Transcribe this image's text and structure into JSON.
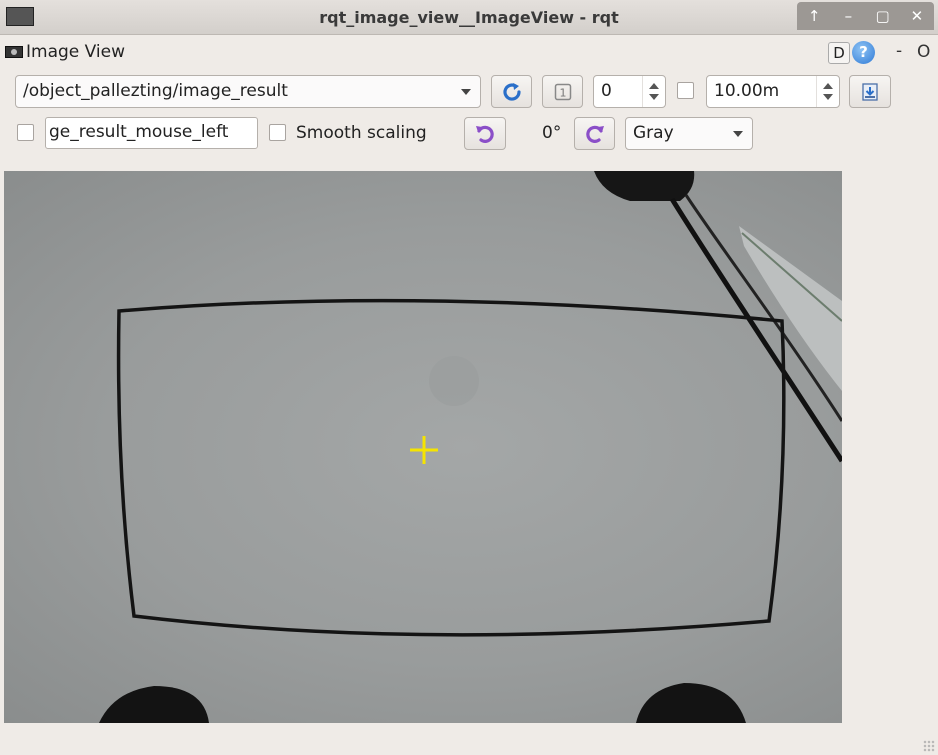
{
  "window": {
    "title": "rqt_image_view__ImageView - rqt",
    "controls": [
      "↑",
      "–",
      "▢",
      "✕"
    ]
  },
  "plugin": {
    "title": "Image View",
    "d_label": "D",
    "help_label": "?",
    "dash_label": "-",
    "close_label": "O"
  },
  "toolbar": {
    "topic_value": "/object_pallezting/image_result",
    "number_value": "0",
    "duration_value": "10.00m",
    "mouse_topic_value": "ge_result_mouse_left",
    "smooth_scaling_label": "Smooth scaling",
    "smooth_scaling_checked": false,
    "mouse_pub_checked": false,
    "duration_checked": false,
    "rotation_label": "0°",
    "color_scheme_value": "Gray"
  },
  "colors": {
    "accent_purple": "#8b4fc8",
    "refresh_blue": "#2a6fc9",
    "crosshair": "#f5e400",
    "titlebar_controls": "#9c9894"
  },
  "icons": {
    "refresh": "refresh-icon",
    "zoom_1": "zoom-original-icon",
    "save": "save-icon",
    "rotate_left": "rotate-left-icon",
    "rotate_right": "rotate-right-icon"
  }
}
